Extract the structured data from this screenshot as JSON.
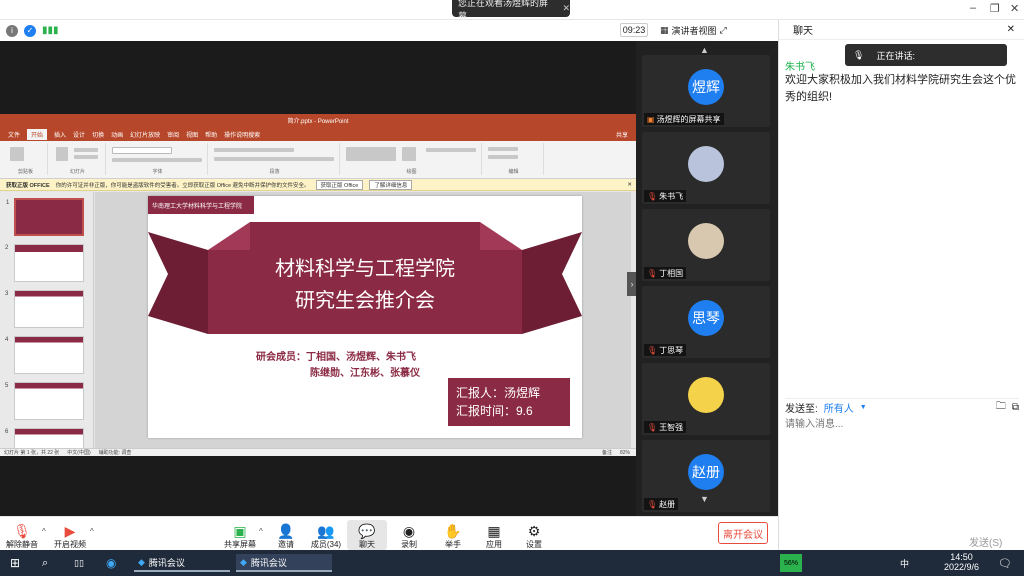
{
  "top": {
    "banner": "您正在观看汤煜辉的屏幕",
    "time": "09:23",
    "view_mode": "演讲者视图"
  },
  "window_controls": [
    "–",
    "❐",
    "✕"
  ],
  "ppt": {
    "title": "简介.pptx - PowerPoint",
    "tabs": [
      "文件",
      "开始",
      "插入",
      "设计",
      "切换",
      "动画",
      "幻灯片放映",
      "审阅",
      "视图",
      "帮助",
      "操作说明搜索"
    ],
    "share": "共享",
    "ribbon_groups": [
      "剪贴板",
      "幻灯片",
      "字体",
      "段落",
      "绘图",
      "编辑"
    ],
    "warning": {
      "label": "获取正版 OFFICE",
      "text": "你的许可证并非正版，你可能是盗版软件的受害者。立即获取正版 Office 避免中断并保护你的文件安全。",
      "btn1": "获取正版 Office",
      "btn2": "了解详细信息"
    },
    "thumb_numbers": [
      "1",
      "2",
      "3",
      "4",
      "5",
      "6"
    ],
    "status": {
      "left": "幻灯片 第 1 张，共 22 张",
      "lang": "中文(中国)",
      "access": "辅助功能: 调查",
      "notes": "备注",
      "zoom": "82%"
    }
  },
  "slide": {
    "logo": "华南理工大学材料科学与工程学院",
    "title1": "材料科学与工程学院",
    "title2": "研究生会推介会",
    "members1": "研会成员：丁相国、汤煜辉、朱书飞",
    "members2": "陈继勋、江东彬、张慕仪",
    "reporter": "汇报人：汤煜辉",
    "date": "汇报时间：9.6"
  },
  "participants": [
    {
      "avatar": "煜辉",
      "name": "汤煜辉的屏幕共享",
      "color": "#1f7ef0"
    },
    {
      "avatar": "",
      "name": "朱书飞",
      "color": "#b9c4dc"
    },
    {
      "avatar": "",
      "name": "丁相国",
      "color": "#d9c8b0"
    },
    {
      "avatar": "思琴",
      "name": "丁思琴",
      "color": "#1f7ef0"
    },
    {
      "avatar": "",
      "name": "王智强",
      "color": "#f4d24a"
    },
    {
      "avatar": "赵册",
      "name": "赵册",
      "color": "#1f7ef0"
    }
  ],
  "chat": {
    "title": "聊天",
    "speaking": "正在讲话:",
    "sender": "朱书飞",
    "message": "欢迎大家积极加入我们材料学院研究生会这个优秀的组织!",
    "send_to_label": "发送至:",
    "send_to_value": "所有人",
    "input_placeholder": "请输入消息...",
    "send_button": "发送(S)"
  },
  "controls": {
    "mute": "解除静音",
    "video": "开启视频",
    "share": "共享屏幕",
    "invite": "邀请",
    "members": "成员(34)",
    "chat": "聊天",
    "record": "录制",
    "hand": "举手",
    "apps": "应用",
    "settings": "设置",
    "leave": "离开会议"
  },
  "taskbar": {
    "app1": "腾讯会议",
    "app2": "腾讯会议",
    "battery": "56%",
    "ime": "中",
    "time": "14:50",
    "date": "2022/9/6"
  },
  "colors": {
    "accent": "#1f7ef0",
    "ppt": "#b7472a",
    "slide": "#8b2a45",
    "leave": "#e84c3d",
    "taskbar": "#1f2a3a"
  }
}
